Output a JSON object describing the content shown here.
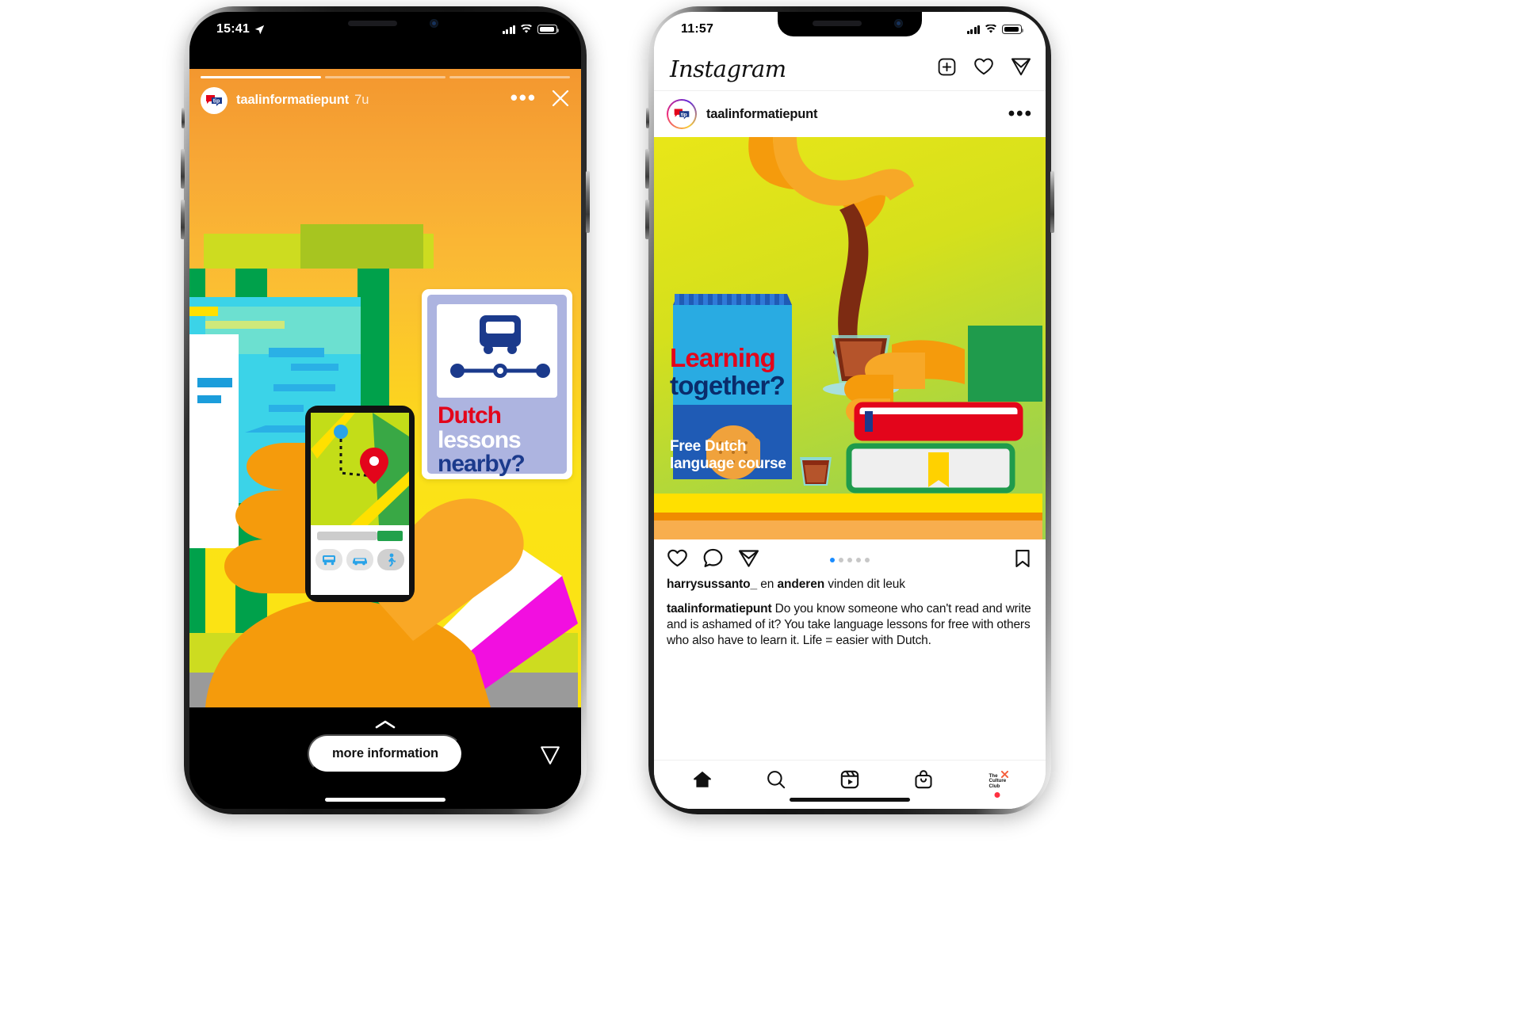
{
  "page": {
    "background": "#ffffff"
  },
  "story_phone": {
    "status_bar": {
      "time": "15:41",
      "location_icon": "location-arrow-icon",
      "signal_icon": "cellular-bars-icon",
      "wifi_icon": "wifi-icon",
      "battery_icon": "battery-icon"
    },
    "header": {
      "username": "taalinformatiepunt",
      "timestamp": "7u",
      "avatar_label": "tip",
      "more_icon": "ellipsis-icon",
      "close_icon": "close-icon",
      "progress_segments": 3,
      "progress_active_index": 0
    },
    "media": {
      "alt": "illustration of hand holding phone with map at a bus stop",
      "background_top": "#f3972f",
      "background_bottom": "#fbe313",
      "sign": {
        "line1": "Dutch",
        "line2": "lessons",
        "line3": "nearby?",
        "line1_color": "#e3051b",
        "line2_color": "#ffffff",
        "line3_color": "#1b3a8c",
        "frame_color": "#adb4e0",
        "pictogram": "bus-route-icon"
      },
      "device_mock": {
        "map_pin_icon": "map-pin-icon",
        "origin_icon": "origin-dot-icon",
        "tabs": [
          "bus-icon",
          "car-icon",
          "walk-icon"
        ],
        "selected_tab_index": 2,
        "search_placeholder": "",
        "go_button_color": "#21a14b"
      }
    },
    "footer": {
      "swipe_up_icon": "chevron-up-icon",
      "cta_label": "more information",
      "send_icon": "send-icon"
    }
  },
  "feed_phone": {
    "status_bar": {
      "time": "11:57",
      "signal_icon": "cellular-bars-icon",
      "wifi_icon": "wifi-icon",
      "battery_icon": "battery-icon"
    },
    "app_header": {
      "logo_text": "Instagram",
      "icons": [
        "new-post-icon",
        "activity-heart-icon",
        "direct-message-icon"
      ]
    },
    "post": {
      "username": "taalinformatiepunt",
      "avatar_label": "tip",
      "more_icon": "ellipsis-icon",
      "media_alt": "illustration of tea being poured, biscuits pack and books",
      "media_texts": {
        "headline_line1": "Learning",
        "headline_line2": "together?",
        "headline_color": "#e3051b",
        "subline1": "Free Dutch",
        "subline2": "language course",
        "subline_color": "#0a2c6b",
        "pack_color": "#1f5bb5"
      },
      "actions": {
        "like_icon": "heart-icon",
        "comment_icon": "comment-bubble-icon",
        "share_icon": "send-icon",
        "save_icon": "bookmark-icon",
        "carousel_dots": 5,
        "carousel_active_index": 0,
        "active_dot_color": "#1a8cff"
      },
      "likes_prefix": "harrysussanto_",
      "likes_mid": " en ",
      "likes_bold2": "anderen",
      "likes_suffix": " vinden dit leuk",
      "caption_author": "taalinformatiepunt",
      "caption_text": " Do you know someone who can't read and write and is ashamed of it? You take language lessons for free with others who also have to learn it. Life = easier with Dutch."
    },
    "tabbar": {
      "items": [
        {
          "name": "home-icon",
          "label": "Home"
        },
        {
          "name": "search-icon",
          "label": "Search"
        },
        {
          "name": "reels-icon",
          "label": "Reels"
        },
        {
          "name": "shop-bag-icon",
          "label": "Shop"
        },
        {
          "name": "profile-avatar",
          "label": "The Culture Club"
        }
      ],
      "avatar_line1": "The",
      "avatar_line2": "Culture",
      "avatar_line3": "Club",
      "badge_color": "#ff3040"
    }
  }
}
